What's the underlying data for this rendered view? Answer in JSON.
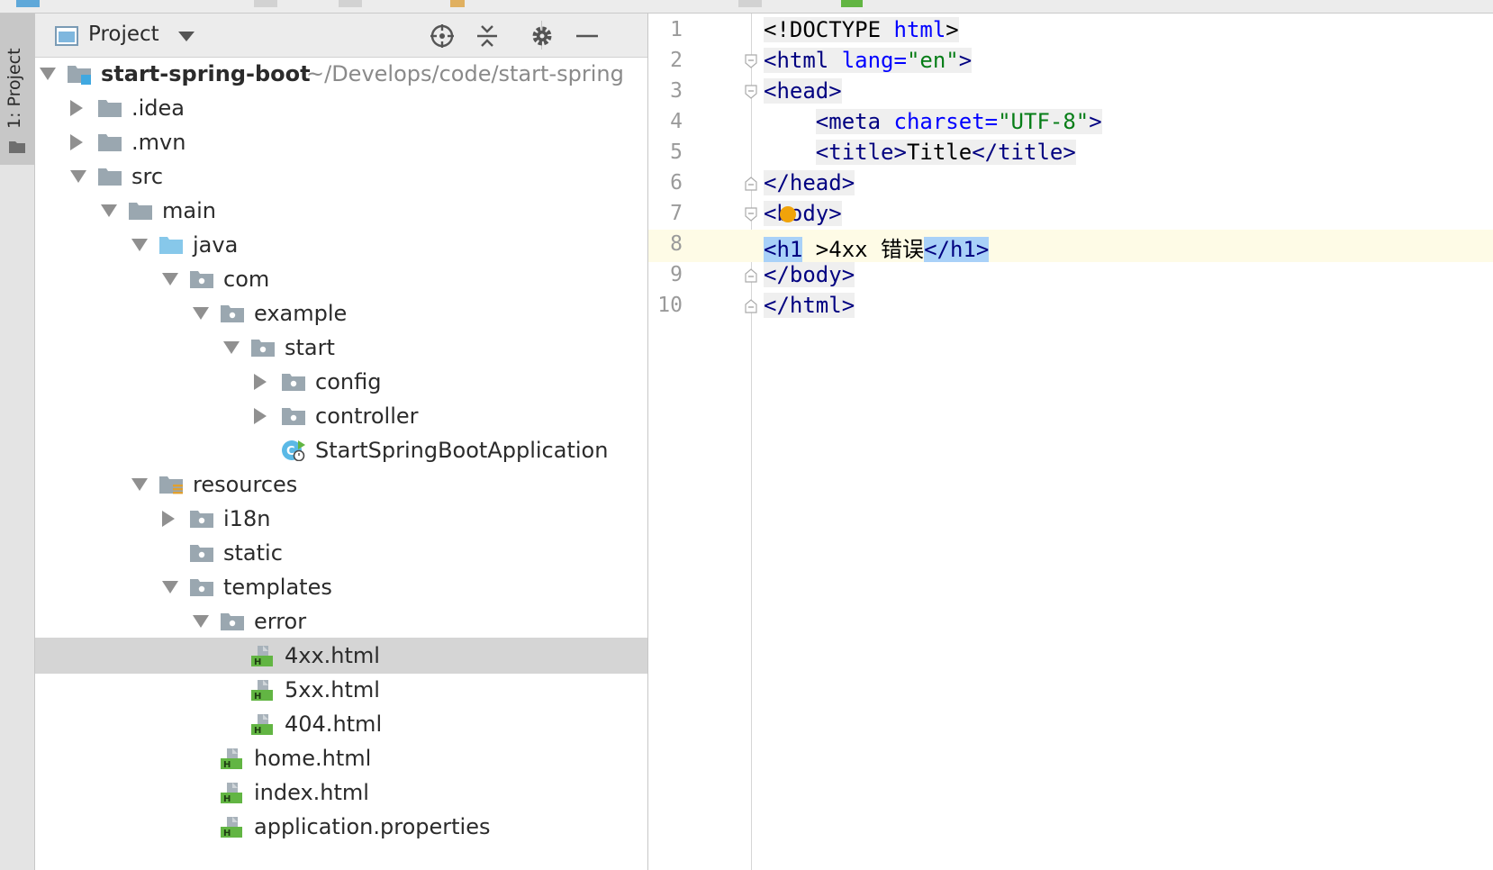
{
  "project_panel": {
    "title": "Project"
  },
  "tool_stripe": {
    "label": "1: Project"
  },
  "tree": [
    {
      "label": "start-spring-boot",
      "path": "~/Develops/code/start-spring",
      "bold": true,
      "icon": "module-folder-icon",
      "arrow": "down",
      "depth": 0
    },
    {
      "label": ".idea",
      "icon": "folder-icon",
      "arrow": "right",
      "depth": 1
    },
    {
      "label": ".mvn",
      "icon": "folder-icon",
      "arrow": "right",
      "depth": 1
    },
    {
      "label": "src",
      "icon": "folder-icon",
      "arrow": "down",
      "depth": 1
    },
    {
      "label": "main",
      "icon": "folder-icon",
      "arrow": "down",
      "depth": 2
    },
    {
      "label": "java",
      "icon": "source-folder-icon",
      "arrow": "down",
      "depth": 3
    },
    {
      "label": "com",
      "icon": "package-icon",
      "arrow": "down",
      "depth": 4
    },
    {
      "label": "example",
      "icon": "package-icon",
      "arrow": "down",
      "depth": 5
    },
    {
      "label": "start",
      "icon": "package-icon",
      "arrow": "down",
      "depth": 6
    },
    {
      "label": "config",
      "icon": "package-icon",
      "arrow": "right",
      "depth": 7
    },
    {
      "label": "controller",
      "icon": "package-icon",
      "arrow": "right",
      "depth": 7
    },
    {
      "label": "StartSpringBootApplication",
      "icon": "spring-class-icon",
      "arrow": "none",
      "depth": 7
    },
    {
      "label": "resources",
      "icon": "resources-folder-icon",
      "arrow": "down",
      "depth": 3
    },
    {
      "label": "i18n",
      "icon": "package-icon",
      "arrow": "right",
      "depth": 4
    },
    {
      "label": "static",
      "icon": "package-icon",
      "arrow": "none",
      "depth": 4
    },
    {
      "label": "templates",
      "icon": "package-icon",
      "arrow": "down",
      "depth": 4
    },
    {
      "label": "error",
      "icon": "package-icon",
      "arrow": "down",
      "depth": 5
    },
    {
      "label": "4xx.html",
      "icon": "html-file-icon",
      "arrow": "none",
      "depth": 6,
      "selected": true
    },
    {
      "label": "5xx.html",
      "icon": "html-file-icon",
      "arrow": "none",
      "depth": 6
    },
    {
      "label": "404.html",
      "icon": "html-file-icon",
      "arrow": "none",
      "depth": 6
    },
    {
      "label": "home.html",
      "icon": "html-file-icon",
      "arrow": "none",
      "depth": 5
    },
    {
      "label": "index.html",
      "icon": "html-file-icon",
      "arrow": "none",
      "depth": 5
    },
    {
      "label": "application.properties",
      "icon": "properties-file-icon",
      "arrow": "none",
      "depth": 5
    }
  ],
  "editor": {
    "current_line": 8,
    "lines": [
      {
        "n": "1",
        "tokens": [
          {
            "t": "<!DOCTYPE ",
            "c": "plain",
            "bg": true
          },
          {
            "t": "html",
            "c": "attr",
            "bg": true
          },
          {
            "t": ">",
            "c": "plain",
            "bg": true
          }
        ]
      },
      {
        "n": "2",
        "fold": "open",
        "tokens": [
          {
            "t": "<html ",
            "c": "tag",
            "bg": true
          },
          {
            "t": "lang=",
            "c": "attr",
            "bg": true
          },
          {
            "t": "\"en\"",
            "c": "str",
            "bg": true
          },
          {
            "t": ">",
            "c": "tag",
            "bg": true
          }
        ]
      },
      {
        "n": "3",
        "fold": "open",
        "tokens": [
          {
            "t": "<head>",
            "c": "tag",
            "bg": true
          }
        ]
      },
      {
        "n": "4",
        "tokens": [
          {
            "t": "    ",
            "c": "plain"
          },
          {
            "t": "<meta ",
            "c": "tag",
            "bg": true
          },
          {
            "t": "charset=",
            "c": "attr",
            "bg": true
          },
          {
            "t": "\"UTF-8\"",
            "c": "str",
            "bg": true
          },
          {
            "t": ">",
            "c": "tag",
            "bg": true
          }
        ]
      },
      {
        "n": "5",
        "tokens": [
          {
            "t": "    ",
            "c": "plain"
          },
          {
            "t": "<title>",
            "c": "tag",
            "bg": true
          },
          {
            "t": "Title",
            "c": "plain",
            "bg": true
          },
          {
            "t": "</title>",
            "c": "tag",
            "bg": true
          }
        ]
      },
      {
        "n": "6",
        "fold": "close",
        "tokens": [
          {
            "t": "</head>",
            "c": "tag",
            "bg": true
          }
        ]
      },
      {
        "n": "7",
        "fold": "open",
        "tokens": [
          {
            "t": "<body>",
            "c": "tag",
            "bg": true
          }
        ]
      },
      {
        "n": "8",
        "tokens": [
          {
            "t": "<h1",
            "c": "tag",
            "hl": true
          },
          {
            "t": " >4xx 错误",
            "c": "plain"
          },
          {
            "t": "</h1>",
            "c": "tag",
            "hl": true
          }
        ]
      },
      {
        "n": "9",
        "fold": "close",
        "tokens": [
          {
            "t": "</body>",
            "c": "tag",
            "bg": true
          }
        ]
      },
      {
        "n": "10",
        "fold": "close",
        "tokens": [
          {
            "t": "</html>",
            "c": "tag",
            "bg": true
          }
        ]
      }
    ]
  },
  "colors": {
    "tag": "#000080",
    "attr": "#0000ff",
    "string": "#067d17",
    "highlight": "#a9d1f8",
    "current_line": "#fefbe6",
    "selection_row": "#d5d5d5",
    "html_icon": "#62b543",
    "bulb": "#f0a30a"
  }
}
